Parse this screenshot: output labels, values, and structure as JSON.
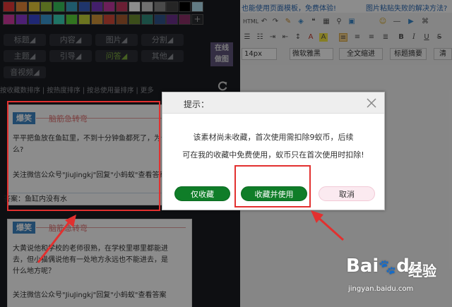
{
  "swatch_colors": [
    "#e83a3a",
    "#e8873a",
    "#e8c93a",
    "#9ec43a",
    "#3ac45b",
    "#3aa5c4",
    "#3a62c4",
    "#7a3ac4",
    "#c43aa3",
    "#c43a5f",
    "#ffffff",
    "#cccccc",
    "#888888",
    "#444444",
    "#000000",
    "#b2e0f0",
    "#d43aa3",
    "#8c3ad4",
    "#3a48d4",
    "#3a9ad4",
    "#3ad4b9",
    "#5ad43a",
    "#c4d43a",
    "#d4953a",
    "#d44a3a",
    "#a85c30",
    "#6c8c30",
    "#308c7c",
    "#30548c",
    "#6c308c",
    "#8c3068"
  ],
  "categories": {
    "row1": [
      "标题◢",
      "内容◢",
      "图片◢",
      "分割◢"
    ],
    "row2": [
      "主题◢",
      "引导◢",
      "问答◢",
      "其他◢"
    ],
    "row3": [
      "音视频◢"
    ]
  },
  "live_logo": "在线\n做图",
  "sort_tabs": "按收藏数排序 | 按热度排序 | 按总使用量排序 | 更多",
  "cards": [
    {
      "badge": "爆笑",
      "subtitle": "脑筋急转弯",
      "lines": [
        "平平把鱼放在鱼缸里，不到十分钟鱼都死了，为什",
        "么?",
        "",
        "关注微信公众号\"JiuJingkj\"回复\"小蚂蚁\"查看答案"
      ],
      "answer": "答案：鱼缸内没有水"
    },
    {
      "badge": "爆笑",
      "subtitle": "脑筋急转弯",
      "lines": [
        "大黄说他和学校的老师很熟，在学校里哪里都能进",
        "去，但小猫偶说他有一处地方永远也不能进去，是",
        "什么地方呢？",
        "",
        "关注微信公众号\"JiuJingkj\"回复\"小蚂蚁\"查看答案"
      ]
    }
  ],
  "editor": {
    "tip_left": "也能使用页面模板，免费体验!",
    "tip_right": "图片粘贴失败的解决方法?",
    "font_size": "14px",
    "font_family": "微软雅黑",
    "indent": "全文缩进",
    "summary": "标题摘要",
    "clear": "清"
  },
  "dialog": {
    "title": "提示：",
    "message_line1": "该素材尚未收藏，首次使用需扣除9蚁币，后续",
    "message_line2": "可在我的收藏中免费使用，蚁币只在首次使用时扣除!",
    "btn_collect": "仅收藏",
    "btn_collect_use": "收藏并使用",
    "btn_cancel": "取消"
  },
  "watermark": {
    "brand": "Bai",
    "brand2": "du",
    "jingyan": "经验",
    "url": "jingyan.baidu.com"
  }
}
